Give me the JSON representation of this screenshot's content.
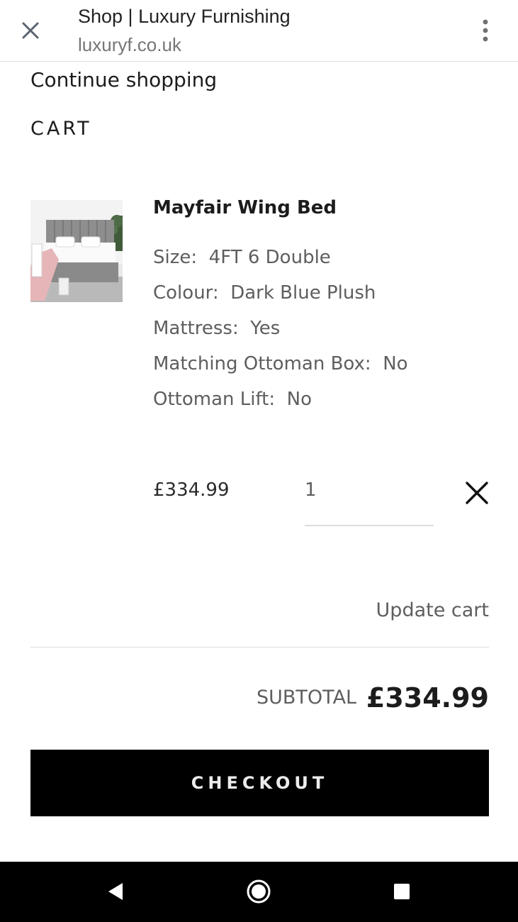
{
  "browser": {
    "title": "Shop | Luxury Furnishing",
    "url": "luxuryf.co.uk",
    "close_icon": "close-icon",
    "menu_icon": "more-vert-icon"
  },
  "page": {
    "continue_label": "Continue shopping",
    "cart_heading": "CART"
  },
  "item": {
    "name": "Mayfair Wing Bed",
    "thumbnail": "bed-product-image",
    "options": [
      {
        "label": "Size:",
        "value": "4FT 6 Double"
      },
      {
        "label": "Colour:",
        "value": "Dark Blue Plush"
      },
      {
        "label": "Mattress:",
        "value": "Yes"
      },
      {
        "label": "Matching Ottoman Box:",
        "value": "No"
      },
      {
        "label": "Ottoman Lift:",
        "value": "No"
      }
    ],
    "price": "£334.99",
    "quantity": "1",
    "remove_icon": "remove-icon"
  },
  "summary": {
    "update_label": "Update cart",
    "subtotal_label": "SUBTOTAL",
    "subtotal_value": "£334.99",
    "checkout_label": "CHECKOUT"
  },
  "system_nav": {
    "back_icon": "back-icon",
    "home_icon": "home-icon",
    "recents_icon": "recents-icon"
  },
  "colors": {
    "primary_text": "#1c1c1c",
    "secondary_text": "#5e5e5e",
    "divider": "#dcdcdc",
    "checkout_bg": "#000000",
    "checkout_text": "#ececec"
  }
}
